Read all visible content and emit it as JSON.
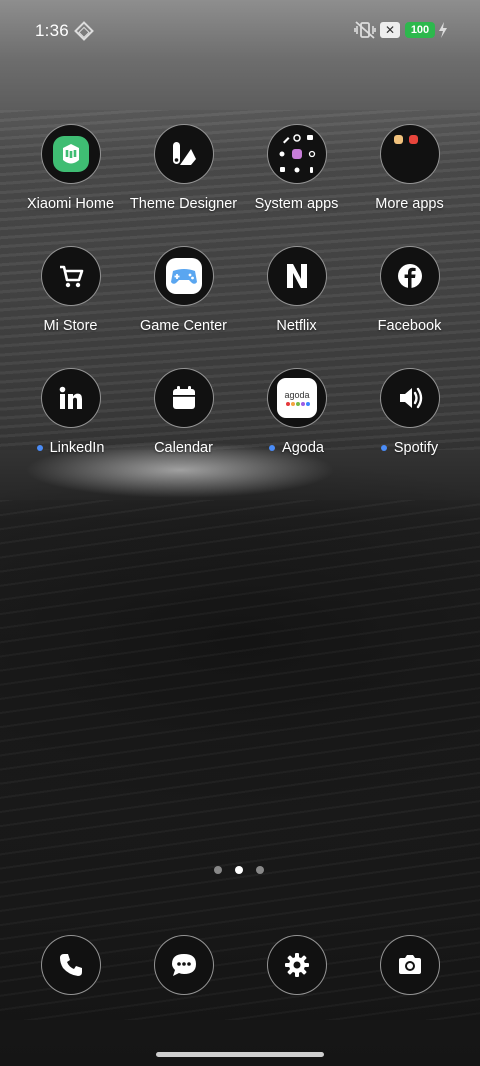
{
  "status_bar": {
    "time": "1:36",
    "battery_level": "100",
    "battery_color": "#2db84d",
    "icons": [
      "shield-diamond-icon",
      "vibrate-off-icon",
      "x-notification-icon",
      "charging-bolt-icon"
    ]
  },
  "apps": [
    [
      {
        "label": "Xiaomi Home",
        "icon": "xiaomi-home-icon",
        "new": false
      },
      {
        "label": "Theme Designer",
        "icon": "theme-designer-icon",
        "new": false
      },
      {
        "label": "System apps",
        "icon": "folder-icon",
        "new": false
      },
      {
        "label": "More apps",
        "icon": "folder-icon",
        "new": false
      }
    ],
    [
      {
        "label": "Mi Store",
        "icon": "cart-icon",
        "new": false
      },
      {
        "label": "Game Center",
        "icon": "gamepad-icon",
        "new": false
      },
      {
        "label": "Netflix",
        "icon": "netflix-icon",
        "new": false
      },
      {
        "label": "Facebook",
        "icon": "facebook-icon",
        "new": false
      }
    ],
    [
      {
        "label": "LinkedIn",
        "icon": "linkedin-icon",
        "new": true
      },
      {
        "label": "Calendar",
        "icon": "calendar-icon",
        "new": false
      },
      {
        "label": "Agoda",
        "icon": "agoda-icon",
        "new": true,
        "logo_text": "agoda"
      },
      {
        "label": "Spotify",
        "icon": "speaker-icon",
        "new": true
      }
    ]
  ],
  "pager": {
    "pages": 3,
    "active": 2
  },
  "dock": [
    {
      "icon": "phone-icon"
    },
    {
      "icon": "messages-icon"
    },
    {
      "icon": "settings-icon"
    },
    {
      "icon": "camera-icon"
    }
  ],
  "new_dot_color": "#4a8cf7"
}
